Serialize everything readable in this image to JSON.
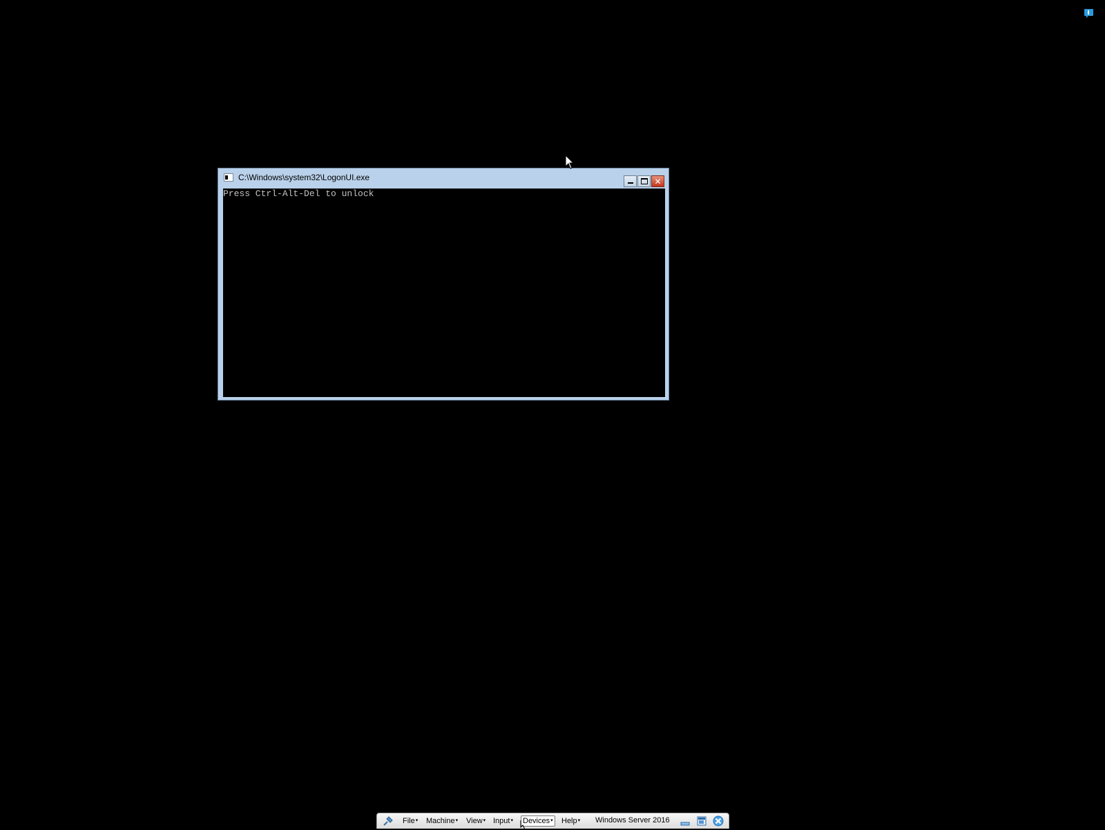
{
  "console": {
    "title": "C:\\Windows\\system32\\LogonUI.exe",
    "text": "Press Ctrl-Alt-Del to unlock",
    "icons": {
      "app": "console-app-icon",
      "minimize": "minimize-icon",
      "maximize": "maximize-icon",
      "close": "close-icon"
    }
  },
  "toolbar": {
    "menus": [
      "File",
      "Machine",
      "View",
      "Input",
      "Devices",
      "Help"
    ],
    "vm_name": "Windows Server 2016",
    "icons": [
      "pin-icon",
      "minimize-window-icon",
      "restore-window-icon",
      "close-vm-icon"
    ]
  },
  "colors": {
    "desktop": "#000000",
    "window_frame": "#b9d1ea",
    "close_button": "#c4361c",
    "console_text": "#c0c0c0"
  }
}
